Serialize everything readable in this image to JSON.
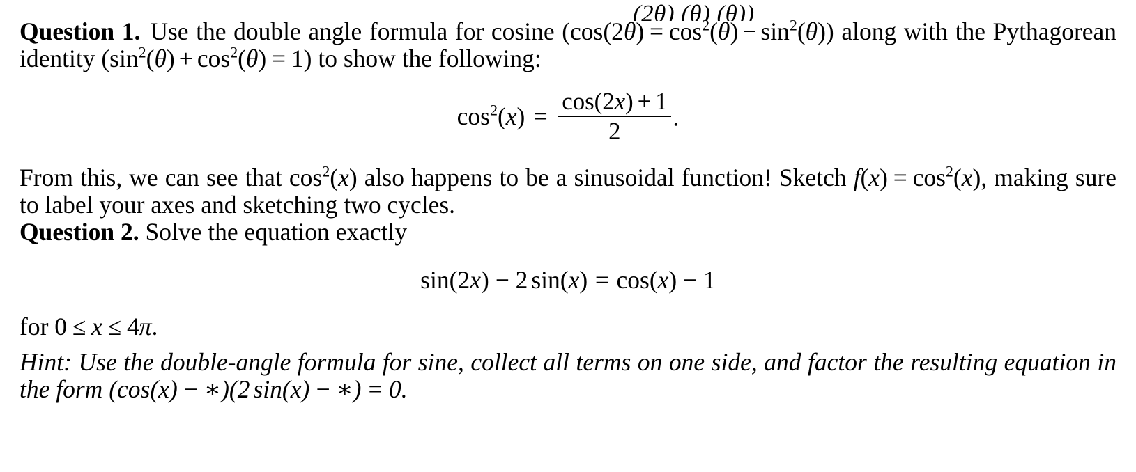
{
  "document": {
    "clipped_top_line": "(2θ)     (θ)     (θ))",
    "question1": {
      "label": "Question 1.",
      "text_part1": "Use the double angle formula for cosine (cos(2",
      "theta": "θ",
      "body_line1_a": "Use the double angle formula for cosine",
      "body_line1_formula": "(cos(2θ) = cos²(θ) − sin²(θ))",
      "body_line1_b": "along with the",
      "body_line2_a": "Pythagorean identity",
      "body_line2_formula": "(sin²(θ) + cos²(θ) = 1)",
      "body_line2_b": "to show the following:",
      "display_equation": {
        "lhs": "cos²(x)",
        "relation": "=",
        "numerator": "cos(2x) + 1",
        "denominator": "2",
        "trailing_punctuation": "."
      },
      "followup_line1_a": "From this, we can see that",
      "followup_line1_formula": "cos²(x)",
      "followup_line1_b": "also happens to be a sinusoidal function! Sketch",
      "followup_line1_formula2": "f(x) = cos²(x)",
      "followup_line1_c": ", making",
      "followup_line2": "sure to label your axes and sketching two cycles."
    },
    "question2": {
      "label": "Question 2.",
      "prompt": "Solve the equation exactly",
      "display_equation": {
        "lhs": "sin(2x) − 2 sin(x)",
        "relation": "=",
        "rhs": "cos(x) − 1"
      },
      "domain_line": "for 0 ≤ x ≤ 4π.",
      "domain_prefix": "for",
      "domain_lower": "0",
      "domain_rel1": "≤",
      "domain_var": "x",
      "domain_rel2": "≤",
      "domain_upper": "4π",
      "domain_period": ".",
      "hint_label": "Hint:",
      "hint_line1": "Use the double-angle formula for sine, collect all terms on one side, and factor the resulting equation",
      "hint_line2_prefix": "in the form",
      "hint_line2_formula": "(cos(x) − ∗)(2 sin(x) − ∗) = 0.",
      "hint_star": "∗"
    },
    "symbols": {
      "theta": "θ",
      "pi": "π",
      "minus": "−",
      "plus": "+",
      "equals": "=",
      "leq": "≤",
      "asterisk": "∗",
      "two": "2",
      "one": "1",
      "zero": "0",
      "four": "4",
      "var_x": "x",
      "func_f": "f",
      "cos": "cos",
      "sin": "sin"
    },
    "colors": {
      "text": "#000000",
      "background": "#ffffff"
    }
  }
}
